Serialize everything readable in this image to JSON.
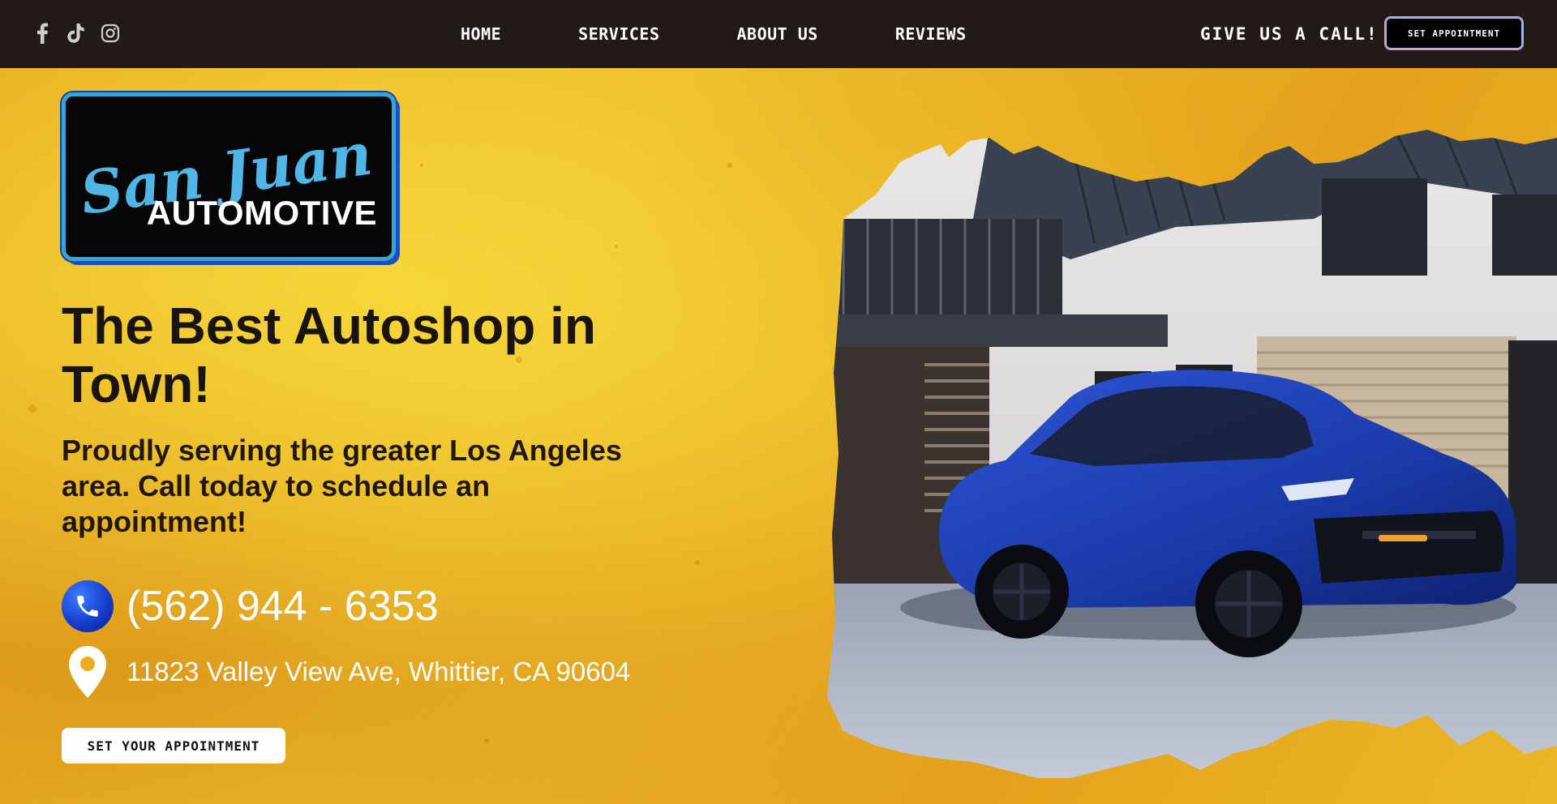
{
  "nav": {
    "social": [
      "facebook-icon",
      "tiktok-icon",
      "instagram-icon"
    ],
    "links": [
      "HOME",
      "SERVICES",
      "ABOUT US",
      "REVIEWS"
    ],
    "call_label": "GIVE US A CALL!",
    "appointment_button": "SET APPOINTMENT"
  },
  "logo": {
    "script_text": "San Juan",
    "subtitle": "AUTOMOTIVE"
  },
  "hero": {
    "title_line1": "The Best Autoshop in",
    "title_line2": "Town!",
    "subtitle": "Proudly serving the greater Los Angeles area. Call today to schedule an appointment!",
    "phone": "(562) 944 - 6353",
    "address": "11823 Valley View Ave, Whittier, CA 90604",
    "cta_button": "SET YOUR APPOINTMENT"
  },
  "colors": {
    "nav_background": "#211a17",
    "hero_yellow": "#f0c52f",
    "title_text": "#1a1410",
    "phone_blue": "#1439c9",
    "car_blue": "#1c3fb0"
  }
}
